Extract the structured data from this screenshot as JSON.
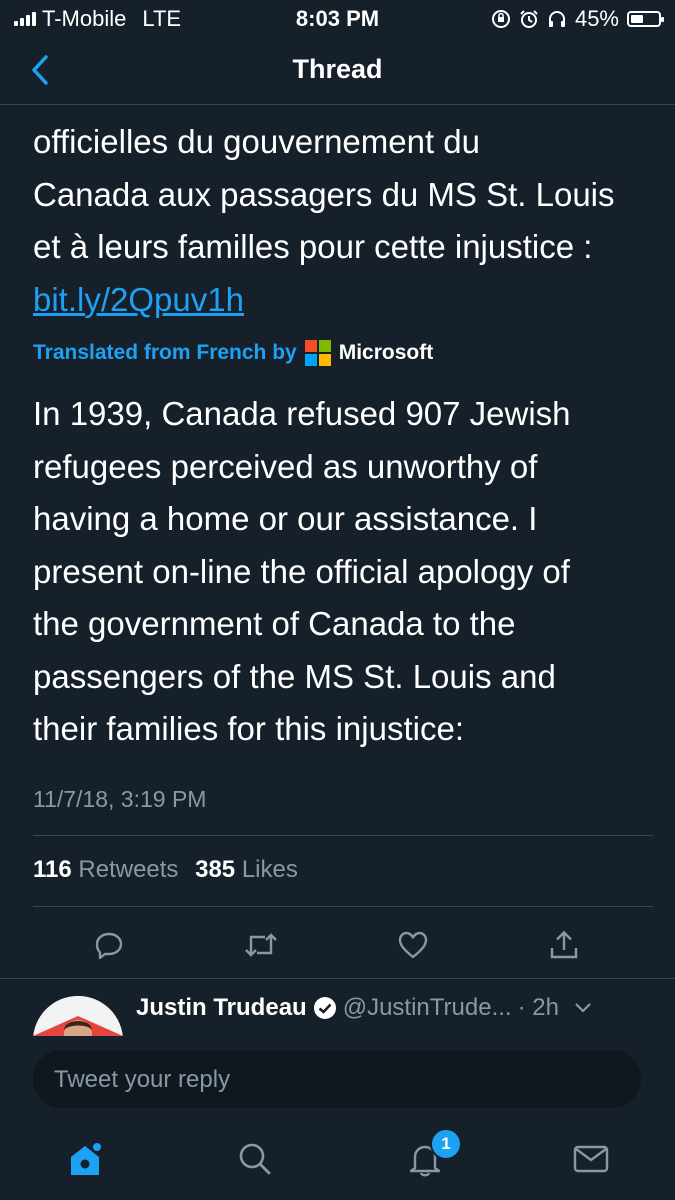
{
  "status_bar": {
    "carrier": "T-Mobile",
    "network": "LTE",
    "time": "8:03 PM",
    "battery": "45%",
    "battery_level": 0.45
  },
  "header": {
    "title": "Thread",
    "back_icon": "chevron-left-icon"
  },
  "tweet": {
    "original_lines": [
      "officielles du gouvernement du",
      "Canada aux passagers du MS St. Louis",
      "et à leurs familles pour cette injustice :"
    ],
    "original_link": "bit.ly/2Qpuv1h",
    "translated_label": "Translated from French by",
    "translator": "Microsoft",
    "translation_lines": [
      "In 1939, Canada refused 907 Jewish",
      "refugees perceived as unworthy of",
      "having a home or our assistance. I",
      "present on-line the official apology of",
      "the government of Canada to the",
      "passengers of the MS St. Louis and",
      "their families for this injustice:"
    ],
    "timestamp": "11/7/18, 3:19 PM",
    "retweets_count": "116",
    "retweets_label": "Retweets",
    "likes_count": "385",
    "likes_label": "Likes"
  },
  "actions": [
    "reply-icon",
    "retweet-icon",
    "like-icon",
    "share-icon"
  ],
  "reply_preview": {
    "name": "Justin Trudeau",
    "handle": "@JustinTrude...",
    "time": "· 2h"
  },
  "compose": {
    "placeholder": "Tweet your reply"
  },
  "tab_bar": {
    "notification_count": "1",
    "tabs": [
      "home-icon",
      "search-icon",
      "notifications-icon",
      "messages-icon"
    ]
  },
  "colors": {
    "background": "#15202b",
    "accent": "#1da1f2",
    "secondary_text": "#8899a6",
    "divider": "#38444d"
  }
}
